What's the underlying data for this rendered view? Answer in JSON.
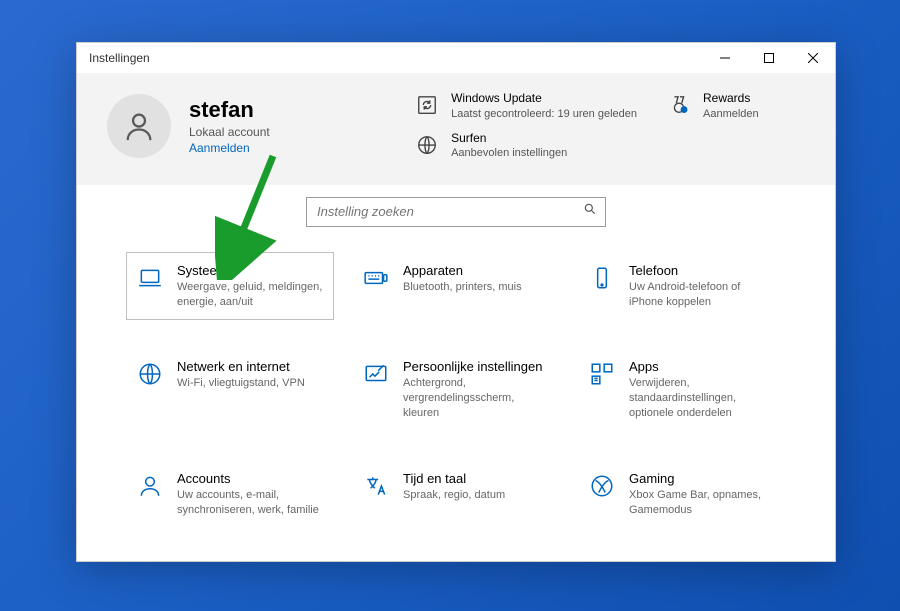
{
  "window_title": "Instellingen",
  "profile": {
    "name": "stefan",
    "account_type": "Lokaal account",
    "signin_label": "Aanmelden"
  },
  "hero_tiles": {
    "update": {
      "title": "Windows Update",
      "desc": "Laatst gecontroleerd: 19 uren geleden"
    },
    "rewards": {
      "title": "Rewards",
      "desc": "Aanmelden"
    },
    "browse": {
      "title": "Surfen",
      "desc": "Aanbevolen instellingen"
    }
  },
  "search": {
    "placeholder": "Instelling zoeken"
  },
  "cards": [
    {
      "id": "system",
      "title": "Systeem",
      "desc": "Weergave, geluid, meldingen, energie, aan/uit",
      "selected": true
    },
    {
      "id": "devices",
      "title": "Apparaten",
      "desc": "Bluetooth, printers, muis"
    },
    {
      "id": "phone",
      "title": "Telefoon",
      "desc": "Uw Android-telefoon of iPhone koppelen"
    },
    {
      "id": "network",
      "title": "Netwerk en internet",
      "desc": "Wi-Fi, vliegtuigstand, VPN"
    },
    {
      "id": "personal",
      "title": "Persoonlijke instellingen",
      "desc": "Achtergrond, vergrendelingsscherm, kleuren"
    },
    {
      "id": "apps",
      "title": "Apps",
      "desc": "Verwijderen, standaardinstellingen, optionele onderdelen"
    },
    {
      "id": "accounts",
      "title": "Accounts",
      "desc": "Uw accounts, e-mail, synchroniseren, werk, familie"
    },
    {
      "id": "time",
      "title": "Tijd en taal",
      "desc": "Spraak, regio, datum"
    },
    {
      "id": "gaming",
      "title": "Gaming",
      "desc": "Xbox Game Bar, opnames, Gamemodus"
    }
  ]
}
